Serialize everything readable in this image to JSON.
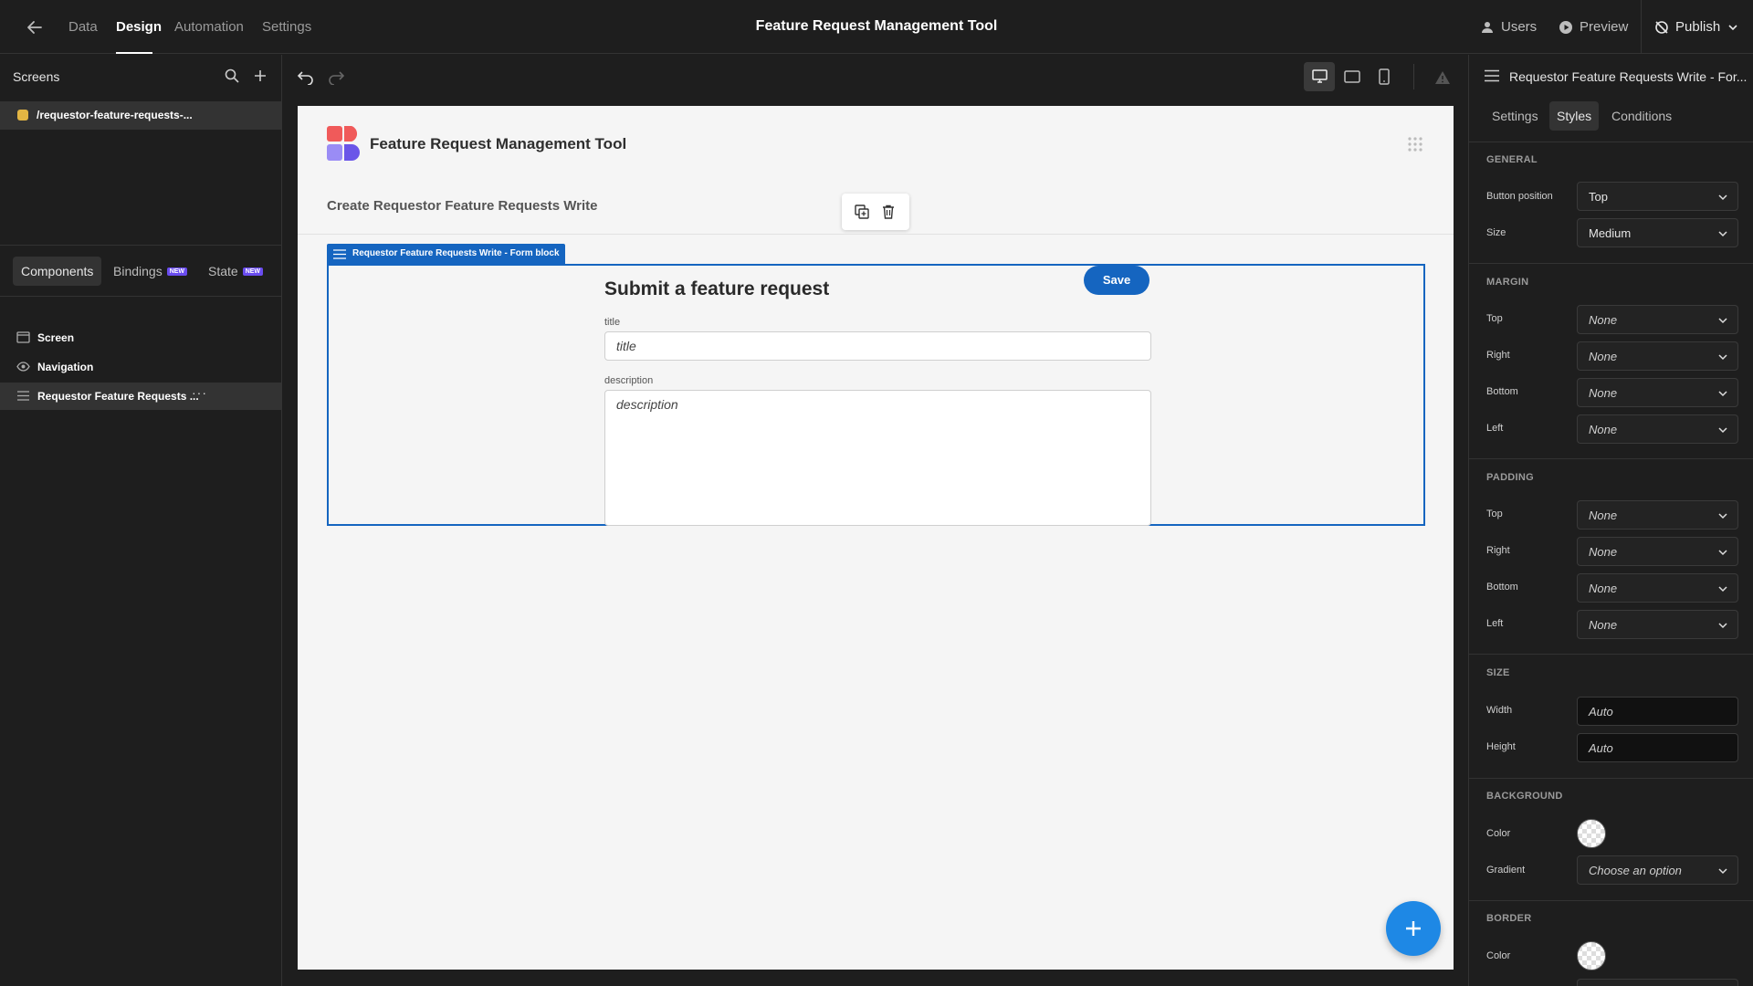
{
  "topbar": {
    "nav": [
      "Data",
      "Design",
      "Automation",
      "Settings"
    ],
    "active_nav": "Design",
    "title": "Feature Request Management Tool",
    "users_label": "Users",
    "preview_label": "Preview",
    "publish_label": "Publish"
  },
  "left_panel": {
    "screens_header": "Screens",
    "screen_item": "/requestor-feature-requests-...",
    "tabs": {
      "components": "Components",
      "bindings": "Bindings",
      "state": "State",
      "new_badge": "NEW"
    },
    "tree": {
      "screen": "Screen",
      "navigation": "Navigation",
      "form_block": "Requestor Feature Requests ...",
      "more": "···"
    }
  },
  "canvas": {
    "app_title": "Feature Request Management Tool",
    "page_subtitle": "Create Requestor Feature Requests Write",
    "form_tag": "Requestor Feature Requests Write - Form block",
    "form_heading": "Submit a feature request",
    "save_label": "Save",
    "fields": {
      "title_label": "title",
      "title_placeholder": "title",
      "description_label": "description",
      "description_placeholder": "description"
    }
  },
  "right_panel": {
    "title": "Requestor Feature Requests Write - For...",
    "tabs": [
      "Settings",
      "Styles",
      "Conditions"
    ],
    "active_tab": "Styles",
    "general": {
      "title": "GENERAL",
      "button_position_label": "Button position",
      "button_position_value": "Top",
      "size_label": "Size",
      "size_value": "Medium"
    },
    "margin": {
      "title": "MARGIN",
      "top_label": "Top",
      "top_value": "None",
      "right_label": "Right",
      "right_value": "None",
      "bottom_label": "Bottom",
      "bottom_value": "None",
      "left_label": "Left",
      "left_value": "None"
    },
    "padding": {
      "title": "PADDING",
      "top_label": "Top",
      "top_value": "None",
      "right_label": "Right",
      "right_value": "None",
      "bottom_label": "Bottom",
      "bottom_value": "None",
      "left_label": "Left",
      "left_value": "None"
    },
    "size": {
      "title": "SIZE",
      "width_label": "Width",
      "width_value": "Auto",
      "height_label": "Height",
      "height_value": "Auto"
    },
    "background": {
      "title": "BACKGROUND",
      "color_label": "Color",
      "gradient_label": "Gradient",
      "gradient_placeholder": "Choose an option"
    },
    "border": {
      "title": "BORDER",
      "color_label": "Color"
    }
  },
  "colors": {
    "accent_blue": "#1565c0",
    "fab_blue": "#1e88e5",
    "screen_dot": "#e2b543",
    "new_badge": "#6a4cf0"
  }
}
